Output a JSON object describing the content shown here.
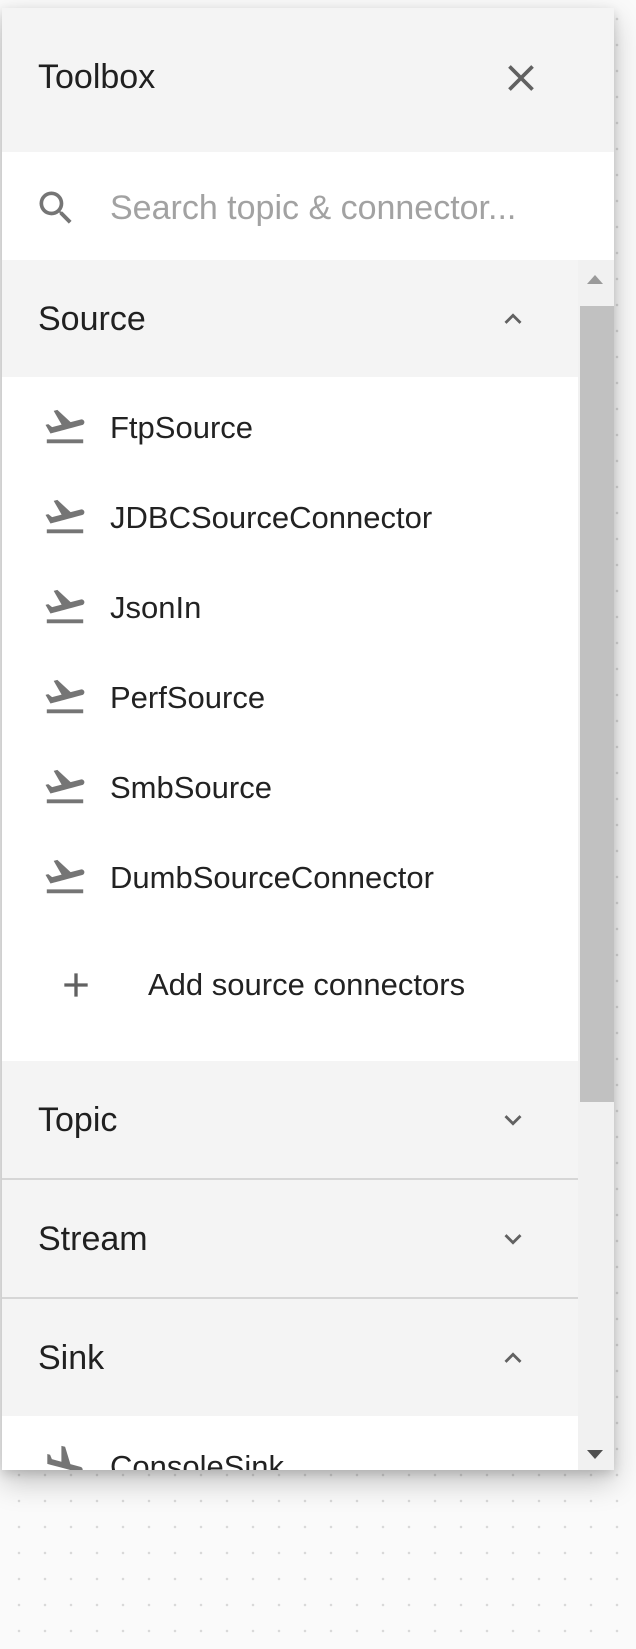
{
  "toolbox": {
    "title": "Toolbox",
    "search": {
      "placeholder": "Search topic & connector..."
    },
    "sections": [
      {
        "title": "Source",
        "expanded": true,
        "items": [
          "FtpSource",
          "JDBCSourceConnector",
          "JsonIn",
          "PerfSource",
          "SmbSource",
          "DumbSourceConnector"
        ],
        "add_label": "Add source connectors"
      },
      {
        "title": "Topic",
        "expanded": false
      },
      {
        "title": "Stream",
        "expanded": false
      },
      {
        "title": "Sink",
        "expanded": true,
        "items": [
          "ConsoleSink"
        ]
      }
    ]
  },
  "icons": {
    "close": "close-icon",
    "search": "search-icon",
    "source_item": "flight-takeoff-icon",
    "sink_item": "flight-land-icon",
    "add": "plus-icon",
    "expanded": "chevron-up-icon",
    "collapsed": "chevron-down-icon"
  },
  "colors": {
    "header_bg": "#f4f4f4",
    "icon_gray": "#757575",
    "text": "#212121",
    "placeholder": "#a2a2a2",
    "scroll_thumb": "#c1c1c1"
  }
}
